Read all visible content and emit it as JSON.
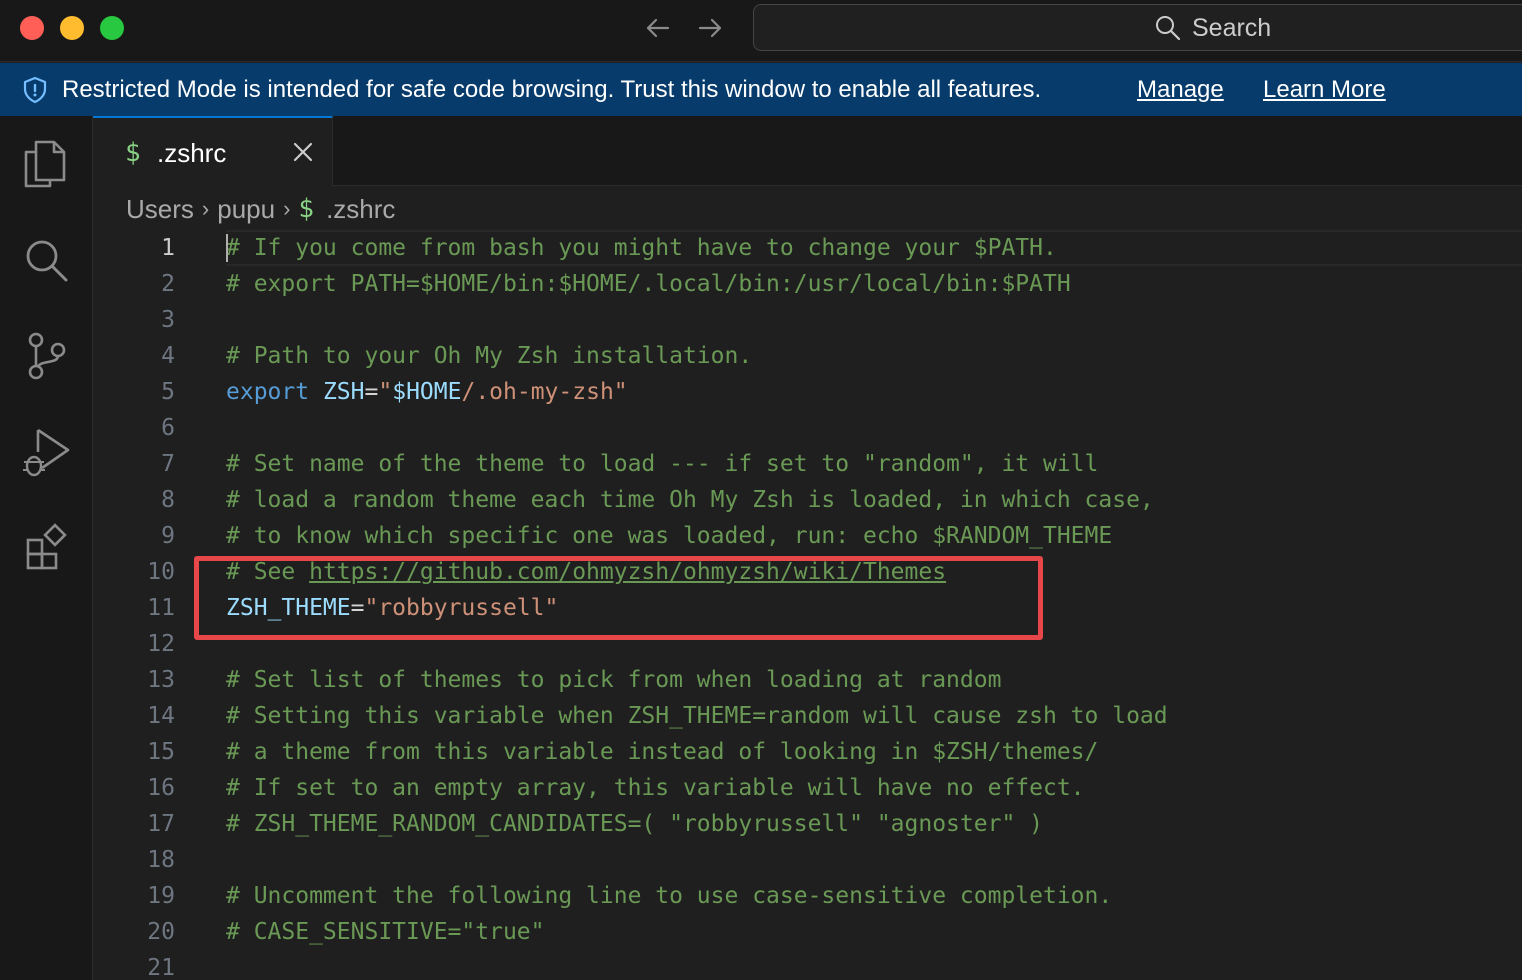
{
  "window": {
    "search_label": "Search"
  },
  "banner": {
    "message": "Restricted Mode is intended for safe code browsing. Trust this window to enable all features.",
    "manage_label": "Manage",
    "learn_more_label": "Learn More"
  },
  "activity_bar": {
    "items": [
      "explorer-icon",
      "search-icon",
      "source-control-icon",
      "run-debug-icon",
      "extensions-icon"
    ]
  },
  "tab": {
    "icon": "$",
    "label": ".zshrc"
  },
  "breadcrumb": {
    "parts": [
      "Users",
      "pupu"
    ],
    "file_icon": "$",
    "file": ".zshrc"
  },
  "editor": {
    "active_line": 1,
    "lines": [
      {
        "n": "1",
        "tokens": [
          {
            "t": "# If you come from bash you might have to change your $PATH.",
            "c": "comment"
          }
        ]
      },
      {
        "n": "2",
        "tokens": [
          {
            "t": "# export PATH=$HOME/bin:$HOME/.local/bin:/usr/local/bin:$PATH",
            "c": "comment"
          }
        ]
      },
      {
        "n": "3",
        "tokens": []
      },
      {
        "n": "4",
        "tokens": [
          {
            "t": "# Path to your Oh My Zsh installation.",
            "c": "comment"
          }
        ]
      },
      {
        "n": "5",
        "tokens": [
          {
            "t": "export",
            "c": "keyword"
          },
          {
            "t": " ",
            "c": "op"
          },
          {
            "t": "ZSH",
            "c": "var"
          },
          {
            "t": "=",
            "c": "op"
          },
          {
            "t": "\"",
            "c": "str"
          },
          {
            "t": "$HOME",
            "c": "var"
          },
          {
            "t": "/.oh-my-zsh\"",
            "c": "str"
          }
        ]
      },
      {
        "n": "6",
        "tokens": []
      },
      {
        "n": "7",
        "tokens": [
          {
            "t": "# Set name of the theme to load --- if set to \"random\", it will",
            "c": "comment"
          }
        ]
      },
      {
        "n": "8",
        "tokens": [
          {
            "t": "# load a random theme each time Oh My Zsh is loaded, in which case,",
            "c": "comment"
          }
        ]
      },
      {
        "n": "9",
        "tokens": [
          {
            "t": "# to know which specific one was loaded, run: echo $RANDOM_THEME",
            "c": "comment"
          }
        ]
      },
      {
        "n": "10",
        "tokens": [
          {
            "t": "# See ",
            "c": "comment"
          },
          {
            "t": "https://github.com/ohmyzsh/ohmyzsh/wiki/Themes",
            "c": "comment url"
          }
        ]
      },
      {
        "n": "11",
        "tokens": [
          {
            "t": "ZSH_THEME",
            "c": "var"
          },
          {
            "t": "=",
            "c": "op"
          },
          {
            "t": "\"robbyrussell\"",
            "c": "str"
          }
        ]
      },
      {
        "n": "12",
        "tokens": []
      },
      {
        "n": "13",
        "tokens": [
          {
            "t": "# Set list of themes to pick from when loading at random",
            "c": "comment"
          }
        ]
      },
      {
        "n": "14",
        "tokens": [
          {
            "t": "# Setting this variable when ZSH_THEME=random will cause zsh to load",
            "c": "comment"
          }
        ]
      },
      {
        "n": "15",
        "tokens": [
          {
            "t": "# a theme from this variable instead of looking in $ZSH/themes/",
            "c": "comment"
          }
        ]
      },
      {
        "n": "16",
        "tokens": [
          {
            "t": "# If set to an empty array, this variable will have no effect.",
            "c": "comment"
          }
        ]
      },
      {
        "n": "17",
        "tokens": [
          {
            "t": "# ZSH_THEME_RANDOM_CANDIDATES=( \"robbyrussell\" \"agnoster\" )",
            "c": "comment"
          }
        ]
      },
      {
        "n": "18",
        "tokens": []
      },
      {
        "n": "19",
        "tokens": [
          {
            "t": "# Uncomment the following line to use case-sensitive completion.",
            "c": "comment"
          }
        ]
      },
      {
        "n": "20",
        "tokens": [
          {
            "t": "# CASE_SENSITIVE=\"true\"",
            "c": "comment"
          }
        ]
      },
      {
        "n": "21",
        "tokens": []
      }
    ]
  },
  "colors": {
    "banner_bg": "#063b6b",
    "highlight_box": "#e8474a",
    "comment": "#6a9955",
    "keyword": "#569cd6",
    "variable": "#9cdcfe",
    "string": "#ce9178"
  }
}
